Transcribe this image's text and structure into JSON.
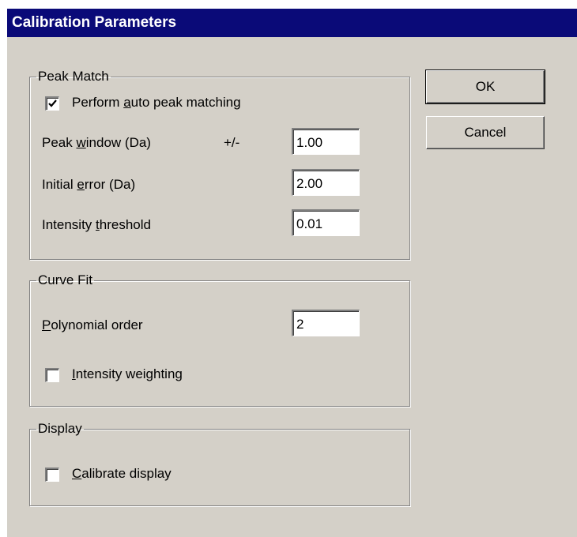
{
  "window": {
    "title": "Calibration Parameters"
  },
  "peak_match": {
    "legend": "Peak Match",
    "auto_peak": {
      "label_pre": "Perform ",
      "label_key": "a",
      "label_post": "uto peak matching",
      "checked": true
    },
    "peak_window": {
      "label_pre": "Peak ",
      "label_key": "w",
      "label_post": "indow (Da)",
      "unit": "+/-",
      "value": "1.00"
    },
    "initial_error": {
      "label_pre": "Initial ",
      "label_key": "e",
      "label_post": "rror (Da)",
      "value": "2.00"
    },
    "intensity_threshold": {
      "label_pre": "Intensity ",
      "label_key": "t",
      "label_post": "hreshold",
      "value": "0.01"
    }
  },
  "curve_fit": {
    "legend": "Curve Fit",
    "polynomial_order": {
      "label_pre": "",
      "label_key": "P",
      "label_post": "olynomial order",
      "value": "2"
    },
    "intensity_weighting": {
      "label_pre": "",
      "label_key": "I",
      "label_post": "ntensity weighting",
      "checked": false
    }
  },
  "display": {
    "legend": "Display",
    "calibrate_display": {
      "label_pre": "",
      "label_key": "C",
      "label_post": "alibrate display",
      "checked": false
    }
  },
  "buttons": {
    "ok": "OK",
    "cancel": "Cancel"
  },
  "colors": {
    "title_bar": "#0a0a78",
    "dialog_face": "#d4d0c8"
  },
  "icons": {
    "checkbox_mark": "checkmark-icon"
  }
}
